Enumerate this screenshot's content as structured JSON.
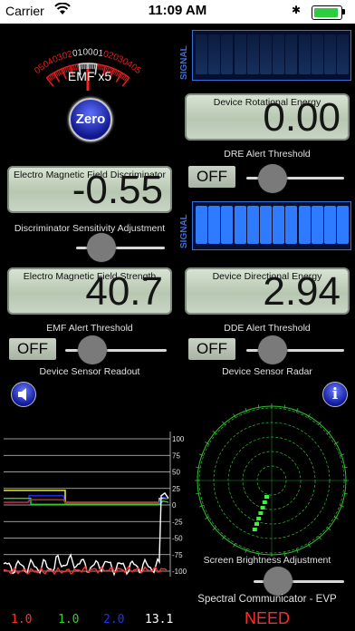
{
  "status": {
    "carrier": "Carrier",
    "time": "11:09 AM"
  },
  "gauge": {
    "label": "EMF x5",
    "ticks": [
      "05",
      "04",
      "03",
      "02",
      "01",
      "00",
      "01",
      "02",
      "03",
      "04",
      "05"
    ]
  },
  "zero_button": "Zero",
  "signal_label": "SIGNAL",
  "signal_top": {
    "level": 0.0
  },
  "signal_mid": {
    "level": 1.0
  },
  "dre": {
    "label": "Device Rotational Energy",
    "value": "0.00"
  },
  "dre_alert": {
    "caption": "DRE Alert Threshold",
    "toggle": "OFF",
    "level": 0.2
  },
  "emfd": {
    "label": "Electro Magnetic Field Discriminator",
    "value": "-0.55"
  },
  "discriminator": {
    "caption": "Discriminator Sensitivity Adjustment",
    "level": 0.22
  },
  "emfs": {
    "label": "Electro Magnetic Field Strength",
    "value": "40.7"
  },
  "dde": {
    "label": "Device Directional Energy",
    "value": "2.94"
  },
  "emf_alert": {
    "caption": "EMF Alert Threshold",
    "toggle": "OFF",
    "level": 0.2
  },
  "dde_alert": {
    "caption": "DDE Alert Threshold",
    "toggle": "OFF",
    "level": 0.2
  },
  "sensor_readout": {
    "caption": "Device Sensor Readout"
  },
  "sensor_radar": {
    "caption": "Device Sensor Radar"
  },
  "speaker_icon": "speaker-icon",
  "info_icon": "info-icon",
  "readout_axis": {
    "labels": [
      "100",
      "75",
      "50",
      "25",
      "0",
      "-25",
      "-50",
      "-75",
      "-100"
    ]
  },
  "brightness": {
    "caption": "Screen Brightness Adjustment",
    "level": 0.2
  },
  "evp": {
    "caption": "Spectral Communicator - EVP",
    "word": "NEED"
  },
  "footer": {
    "red": "1.0",
    "green": "1.0",
    "blue": "2.0",
    "white": "13.1"
  },
  "colors": {
    "signal_on": "#2f7bff",
    "lcd_bg": "#c3cfbf",
    "evp_word": "#ff2a2a",
    "trace_red": "#ff3030",
    "trace_white": "#ffffff",
    "trace_yellow": "#ffff33",
    "trace_blue": "#2030ff",
    "trace_green": "#30d030",
    "radar": "#2fbf2f"
  }
}
